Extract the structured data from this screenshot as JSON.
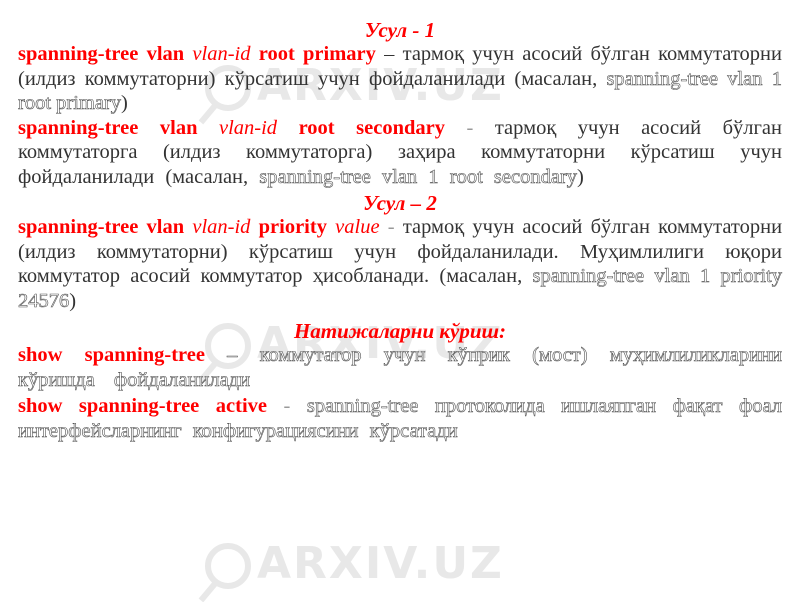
{
  "watermark": "ARXIV.UZ",
  "section1": {
    "heading": "Усул - 1",
    "item1": {
      "cmd_a": "spanning-tree vlan",
      "arg": "vlan-id",
      "cmd_b": "root primary",
      "dash": "–",
      "text": "тармоқ учун асосий бўлган коммутаторни (илдиз коммутаторни) кўрсатиш учун фойдаланилади (масалан,",
      "example": "spanning-tree vlan 1 root primary",
      "close": ")"
    },
    "item2": {
      "cmd_a": "spanning-tree vlan",
      "arg": "vlan-id",
      "cmd_b": "root secondary",
      "dash": "-",
      "text": "тармоқ учун асосий бўлган коммутаторга (илдиз коммутаторга) заҳира коммутаторни кўрсатиш учун фойдаланилади (масалан,",
      "example": "spanning-tree vlan 1 root secondary",
      "close": ")"
    }
  },
  "section2": {
    "heading": "Усул – 2",
    "item1": {
      "cmd_a": "spanning-tree vlan",
      "arg": "vlan-id",
      "cmd_b": "priority",
      "arg2": "value",
      "dash": "-",
      "text": "тармоқ учун асосий бўлган коммутаторни (илдиз коммутаторни) кўрсатиш учун фойдаланилади. Муҳимлилиги юқори коммутатор асосий коммутатор ҳисобланади. (масалан,",
      "example": "spanning-tree vlan 1 priority 24576",
      "close": ")"
    }
  },
  "section3": {
    "heading": "Натижаларни кўриш:",
    "item1": {
      "cmd": "show spanning-tree",
      "dash": "–",
      "text": "коммутатор учун кўприк (мост) муҳимлиликларини кўришда фойдаланилади"
    },
    "item2": {
      "cmd": "show spanning-tree active",
      "dash": "-",
      "example": "spanning-tree",
      "text": "протоколида ишлаяпган фақат фоал интерфейсларнинг конфигурациясини кўрсатади"
    }
  }
}
